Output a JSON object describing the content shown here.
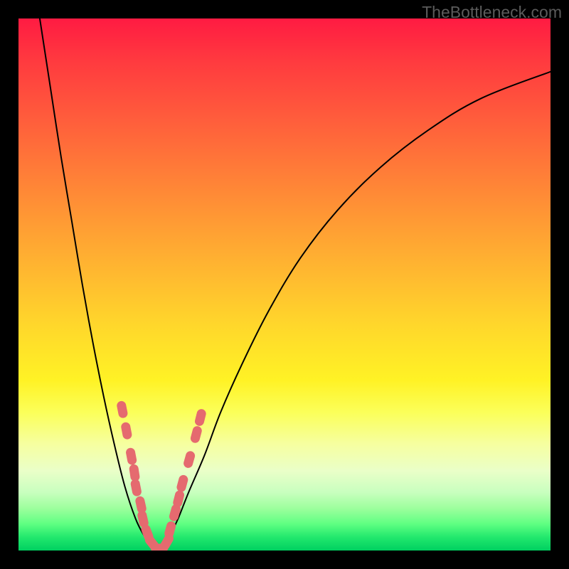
{
  "watermark_text": "TheBottleneck.com",
  "colors": {
    "frame": "#000000",
    "curve_stroke": "#000000",
    "marker_fill": "#e56a6f",
    "marker_stroke": "#d95a60"
  },
  "chart_data": {
    "type": "line",
    "title": "",
    "xlabel": "",
    "ylabel": "",
    "xlim": [
      0,
      100
    ],
    "ylim": [
      0,
      100
    ],
    "grid": false,
    "legend": false,
    "series": [
      {
        "name": "left-branch",
        "x": [
          4,
          6,
          8,
          10,
          12,
          14,
          16,
          18,
          20,
          22,
          23.5,
          25,
          26
        ],
        "y": [
          100,
          87,
          74,
          62,
          50,
          39,
          29,
          20,
          12,
          6,
          3,
          1,
          0
        ]
      },
      {
        "name": "right-branch",
        "x": [
          26,
          27,
          28.5,
          30,
          32,
          35,
          38,
          42,
          47,
          53,
          60,
          68,
          77,
          87,
          100
        ],
        "y": [
          0,
          1,
          3,
          6,
          11,
          18,
          26,
          35,
          45,
          55,
          64,
          72,
          79,
          85,
          90
        ]
      }
    ],
    "markers": {
      "name": "highlighted-region",
      "shape": "pill",
      "points": [
        {
          "x": 19.5,
          "y": 26.5
        },
        {
          "x": 20.3,
          "y": 22.5
        },
        {
          "x": 21.2,
          "y": 17.7
        },
        {
          "x": 21.8,
          "y": 14.6
        },
        {
          "x": 22.1,
          "y": 11.8
        },
        {
          "x": 23.0,
          "y": 8.6
        },
        {
          "x": 23.4,
          "y": 5.9
        },
        {
          "x": 24.2,
          "y": 3.3
        },
        {
          "x": 25.1,
          "y": 1.4
        },
        {
          "x": 26.5,
          "y": 0.4
        },
        {
          "x": 27.9,
          "y": 1.6
        },
        {
          "x": 28.5,
          "y": 3.9
        },
        {
          "x": 29.4,
          "y": 7.1
        },
        {
          "x": 30.1,
          "y": 9.7
        },
        {
          "x": 30.8,
          "y": 12.6
        },
        {
          "x": 32.1,
          "y": 17.1
        },
        {
          "x": 33.4,
          "y": 21.8
        },
        {
          "x": 34.2,
          "y": 25.0
        }
      ]
    }
  }
}
